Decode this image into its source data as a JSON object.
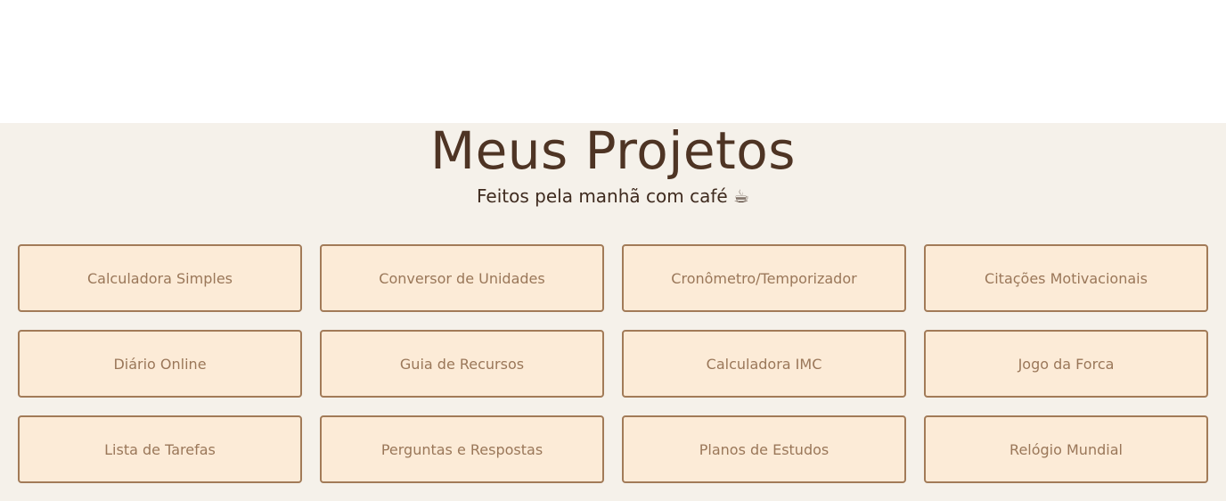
{
  "header": {
    "title": "Meus Projetos",
    "subtitle": "Feitos pela manhã com café ☕"
  },
  "projects": [
    {
      "label": "Calculadora Simples"
    },
    {
      "label": "Conversor de Unidades"
    },
    {
      "label": "Cronômetro/Temporizador"
    },
    {
      "label": "Citações Motivacionais"
    },
    {
      "label": "Diário Online"
    },
    {
      "label": "Guia de Recursos"
    },
    {
      "label": "Calculadora IMC"
    },
    {
      "label": "Jogo da Forca"
    },
    {
      "label": "Lista de Tarefas"
    },
    {
      "label": "Perguntas e Respostas"
    },
    {
      "label": "Planos de Estudos"
    },
    {
      "label": "Relógio Mundial"
    }
  ],
  "colors": {
    "section_background": "#f5f1ea",
    "card_background": "#fcebd7",
    "card_border": "#a27b58",
    "card_text": "#9a7759",
    "title_text": "#4e3424"
  }
}
